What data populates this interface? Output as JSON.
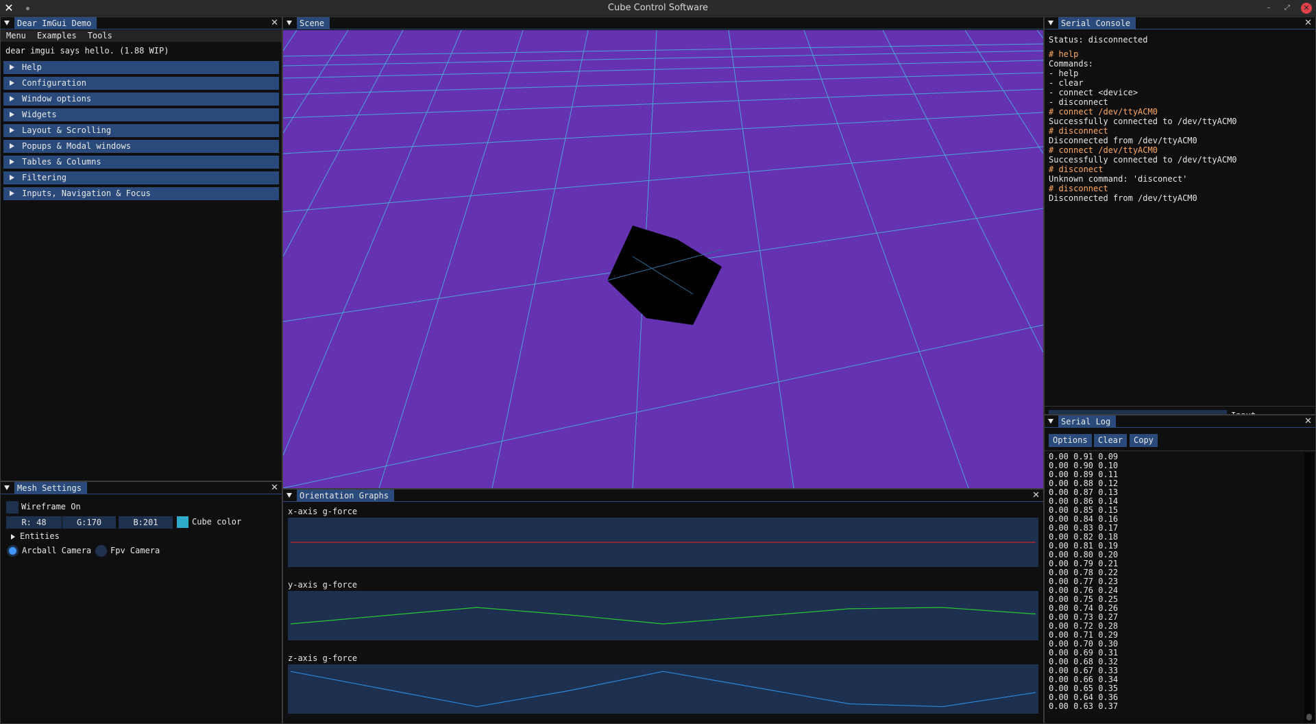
{
  "app": {
    "title": "Cube Control Software"
  },
  "demo": {
    "title": "Dear ImGui Demo",
    "menu": [
      "Menu",
      "Examples",
      "Tools"
    ],
    "hello": "dear imgui says hello. (1.88 WIP)",
    "headers": [
      "Help",
      "Configuration",
      "Window options",
      "Widgets",
      "Layout & Scrolling",
      "Popups & Modal windows",
      "Tables & Columns",
      "Filtering",
      "Inputs, Navigation & Focus"
    ]
  },
  "scene": {
    "title": "Scene",
    "background": "#6532b2",
    "grid_color": "#4aa6d6",
    "cube_color": "#000000"
  },
  "mesh": {
    "title": "Mesh Settings",
    "wireframe_label": "Wireframe On",
    "r": "R: 48",
    "g": "G:170",
    "b": "B:201",
    "color_label": "Cube color",
    "color_value": "#30aac9",
    "entities_label": "Entities",
    "arcball_label": "Arcball Camera",
    "fpv_label": "Fpv Camera"
  },
  "graphs": {
    "title": "Orientation Graphs",
    "x_label": "x-axis g-force",
    "y_label": "y-axis g-force",
    "z_label": "z-axis g-force"
  },
  "chart_data": [
    {
      "type": "line",
      "title": "x-axis g-force",
      "series": [
        {
          "color": "#c42b2b",
          "values": [
            0.0,
            0.0,
            0.0,
            0.0,
            0.0,
            0.0,
            0.0,
            0.0,
            0.0
          ]
        }
      ],
      "ylim": [
        -1,
        1
      ]
    },
    {
      "type": "line",
      "title": "y-axis g-force",
      "series": [
        {
          "color": "#28c832",
          "values": [
            0.0,
            0.25,
            0.5,
            0.27,
            0.0,
            0.23,
            0.46,
            0.5,
            0.3
          ]
        }
      ],
      "ylim": [
        -0.5,
        1
      ]
    },
    {
      "type": "line",
      "title": "z-axis g-force",
      "series": [
        {
          "color": "#2a86d8",
          "values": [
            1.0,
            0.75,
            0.5,
            0.73,
            1.0,
            0.77,
            0.54,
            0.5,
            0.7
          ]
        }
      ],
      "ylim": [
        0.4,
        1.1
      ]
    }
  ],
  "console": {
    "title": "Serial Console",
    "status": "Status: disconnected",
    "lines": [
      {
        "cmd": true,
        "text": "# help"
      },
      {
        "cmd": false,
        "text": "Commands:"
      },
      {
        "cmd": false,
        "text": "- help"
      },
      {
        "cmd": false,
        "text": "- clear"
      },
      {
        "cmd": false,
        "text": "- connect <device>"
      },
      {
        "cmd": false,
        "text": "- disconnect"
      },
      {
        "cmd": true,
        "text": "# connect /dev/ttyACM0"
      },
      {
        "cmd": false,
        "text": "Successfully connected to /dev/ttyACM0"
      },
      {
        "cmd": true,
        "text": "# disconnect"
      },
      {
        "cmd": false,
        "text": "Disconnected from /dev/ttyACM0"
      },
      {
        "cmd": true,
        "text": "# connect /dev/ttyACM0"
      },
      {
        "cmd": false,
        "text": "Successfully connected to /dev/ttyACM0"
      },
      {
        "cmd": true,
        "text": "# disconect"
      },
      {
        "cmd": false,
        "text": "Unknown command: 'disconect'"
      },
      {
        "cmd": true,
        "text": "# disconnect"
      },
      {
        "cmd": false,
        "text": "Disconnected from /dev/ttyACM0"
      }
    ],
    "input_label": "Input"
  },
  "log": {
    "title": "Serial Log",
    "buttons": [
      "Options",
      "Clear",
      "Copy"
    ],
    "lines": [
      "0.00 0.91 0.09",
      "0.00 0.90 0.10",
      "0.00 0.89 0.11",
      "0.00 0.88 0.12",
      "0.00 0.87 0.13",
      "0.00 0.86 0.14",
      "0.00 0.85 0.15",
      "0.00 0.84 0.16",
      "0.00 0.83 0.17",
      "0.00 0.82 0.18",
      "0.00 0.81 0.19",
      "0.00 0.80 0.20",
      "0.00 0.79 0.21",
      "0.00 0.78 0.22",
      "0.00 0.77 0.23",
      "0.00 0.76 0.24",
      "0.00 0.75 0.25",
      "0.00 0.74 0.26",
      "0.00 0.73 0.27",
      "0.00 0.72 0.28",
      "0.00 0.71 0.29",
      "0.00 0.70 0.30",
      "0.00 0.69 0.31",
      "0.00 0.68 0.32",
      "0.00 0.67 0.33",
      "0.00 0.66 0.34",
      "0.00 0.65 0.35",
      "0.00 0.64 0.36",
      "0.00 0.63 0.37"
    ]
  }
}
